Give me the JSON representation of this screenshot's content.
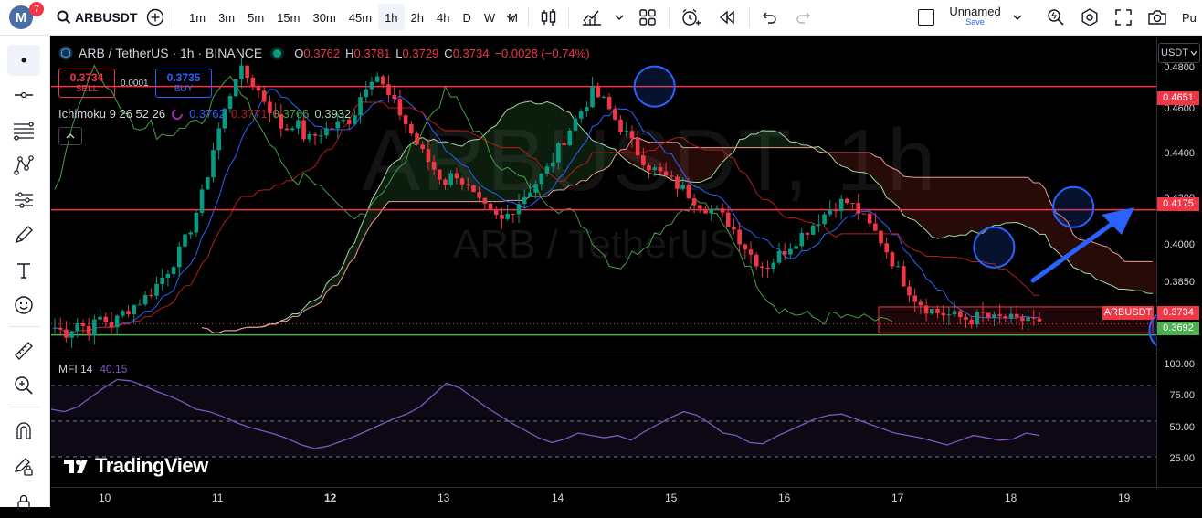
{
  "toolbar": {
    "avatar_letter": "M",
    "notif_count": "7",
    "symbol": "ARBUSDT",
    "intervals": [
      "1m",
      "3m",
      "5m",
      "15m",
      "30m",
      "45m",
      "1h",
      "2h",
      "4h",
      "D",
      "W",
      "M"
    ],
    "active_interval": "1h",
    "layout_name": "Unnamed",
    "save_label": "Save",
    "publish_label": "Pu"
  },
  "legend": {
    "pair": "ARB / TetherUS · 1h · BINANCE",
    "o_label": "O",
    "o": "0.3762",
    "h_label": "H",
    "h": "0.3781",
    "l_label": "L",
    "l": "0.3729",
    "c_label": "C",
    "c": "0.3734",
    "change": "−0.0028 (−0.74%)",
    "sell_price": "0.3734",
    "sell_label": "SELL",
    "spread": "0.0001",
    "buy_price": "0.3735",
    "buy_label": "BUY",
    "ichimoku_label": "Ichimoku 9 26 52 26",
    "ichimoku_values": [
      "0.3762",
      "0.3771",
      "0.3766",
      "0.3932"
    ]
  },
  "watermark": {
    "big": "ARBUSDT, 1h",
    "small": "ARB / TetherUS"
  },
  "currency": "USDT",
  "price_axis": [
    "0.4800",
    "0.4600",
    "0.4400",
    "0.4200",
    "0.4000",
    "0.3850"
  ],
  "price_tags": {
    "resistance_top": "0.4651",
    "resistance_mid": "0.4175",
    "symbol_label": "ARBUSDT",
    "last_price": "0.3734",
    "support": "0.3692"
  },
  "mfi": {
    "label": "MFI 14",
    "value": "40.15",
    "axis": [
      "100.00",
      "75.00",
      "50.00",
      "25.00"
    ]
  },
  "time_axis": [
    "10",
    "11",
    "12",
    "13",
    "14",
    "15",
    "16",
    "17",
    "18",
    "19"
  ],
  "branding": "TradingView",
  "colors": {
    "up": "#089981",
    "down": "#f23645",
    "resistance": "#f23645",
    "support": "#4caf50",
    "mfi": "#7e57c2",
    "marker": "#2962ff"
  },
  "chart_data": {
    "type": "candlestick",
    "price_range": [
      0.362,
      0.484
    ],
    "close_path": [
      0.372,
      0.37,
      0.374,
      0.371,
      0.376,
      0.373,
      0.378,
      0.381,
      0.384,
      0.389,
      0.395,
      0.402,
      0.412,
      0.425,
      0.444,
      0.458,
      0.472,
      0.468,
      0.462,
      0.455,
      0.448,
      0.452,
      0.444,
      0.447,
      0.449,
      0.451,
      0.453,
      0.465,
      0.471,
      0.462,
      0.456,
      0.448,
      0.44,
      0.434,
      0.428,
      0.432,
      0.426,
      0.42,
      0.416,
      0.413,
      0.418,
      0.423,
      0.428,
      0.433,
      0.441,
      0.449,
      0.456,
      0.463,
      0.459,
      0.452,
      0.446,
      0.439,
      0.434,
      0.431,
      0.428,
      0.425,
      0.421,
      0.418,
      0.416,
      0.412,
      0.405,
      0.399,
      0.395,
      0.399,
      0.403,
      0.407,
      0.411,
      0.415,
      0.419,
      0.421,
      0.418,
      0.412,
      0.407,
      0.399,
      0.391,
      0.384,
      0.38,
      0.378,
      0.377,
      0.376,
      0.375,
      0.377,
      0.375,
      0.376,
      0.374,
      0.376,
      0.373
    ],
    "resistance_levels": [
      0.4651,
      0.4175
    ],
    "support_level": 0.3692,
    "mfi_values": [
      60,
      58,
      62,
      70,
      78,
      85,
      84,
      80,
      75,
      71,
      66,
      60,
      58,
      54,
      49,
      45,
      42,
      39,
      35,
      30,
      27,
      29,
      33,
      37,
      42,
      47,
      52,
      56,
      62,
      72,
      82,
      78,
      70,
      62,
      55,
      48,
      42,
      36,
      32,
      35,
      40,
      38,
      36,
      38,
      34,
      41,
      47,
      53,
      58,
      55,
      48,
      40,
      38,
      32,
      31,
      37,
      42,
      47,
      52,
      55,
      56,
      52,
      48,
      44,
      40,
      38,
      36,
      33,
      30,
      34,
      38,
      36,
      34,
      35,
      40,
      38
    ]
  }
}
